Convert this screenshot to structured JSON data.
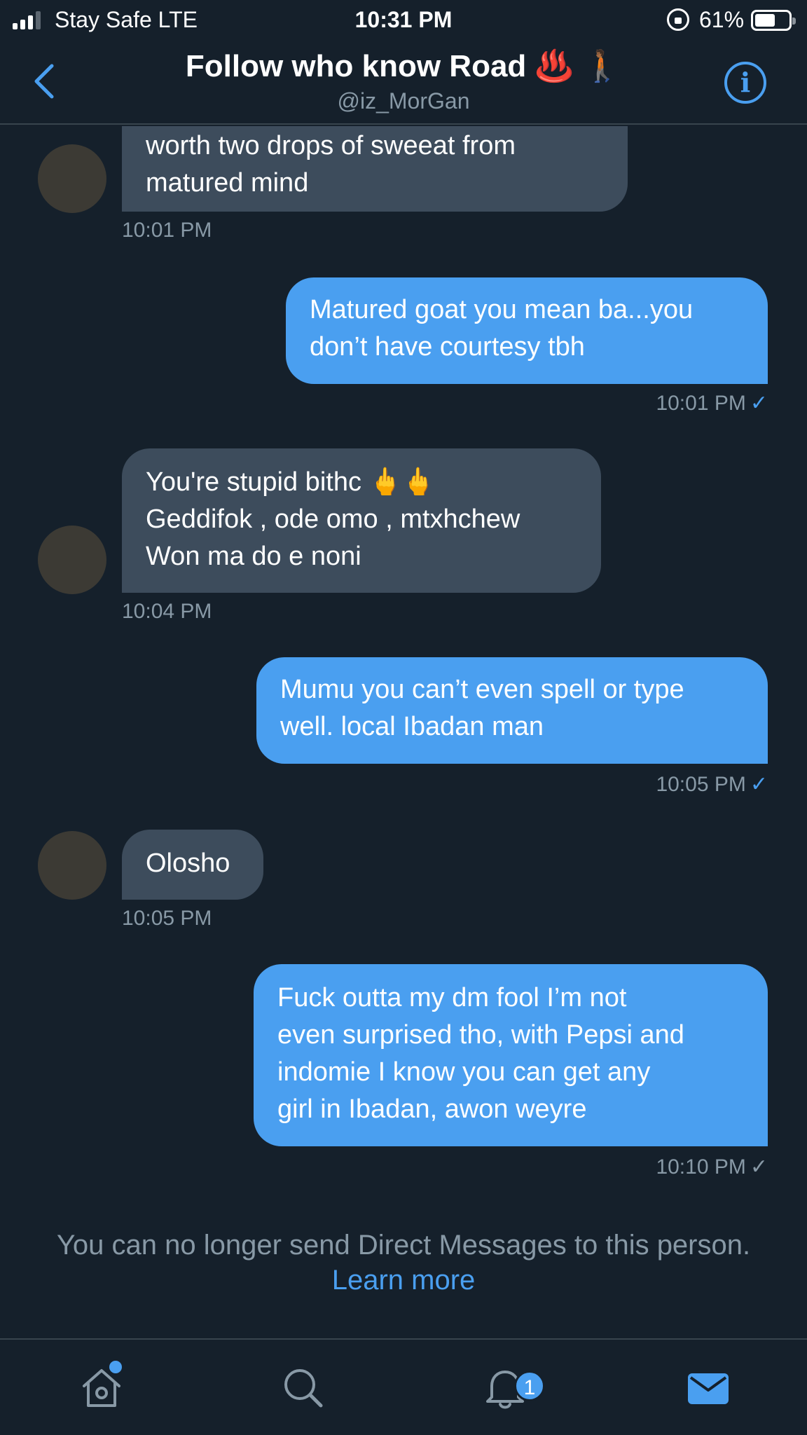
{
  "status_bar": {
    "carrier": "Stay Safe  LTE",
    "time": "10:31 PM",
    "battery_percent": "61%",
    "battery_level": 0.61
  },
  "header": {
    "title": "Follow who know Road",
    "title_emoji": "♨️ 🚶🏾",
    "handle": "@iz_MorGan",
    "info_icon": "i"
  },
  "messages": [
    {
      "direction": "in",
      "lines": [
        "worth two drops of sweeat from",
        "matured mind"
      ],
      "time": "10:01 PM"
    },
    {
      "direction": "out",
      "lines": [
        "Matured goat you mean ba...you",
        "don’t have courtesy tbh"
      ],
      "time": "10:01 PM",
      "status": "✓"
    },
    {
      "direction": "in",
      "lines": [
        "You're stupid bithc 🖕🖕",
        "Geddifok , ode omo ,  mtxhchew",
        "Won ma do e noni"
      ],
      "time": "10:04 PM"
    },
    {
      "direction": "out",
      "lines": [
        "Mumu you can’t even spell or type",
        "well. local Ibadan man"
      ],
      "time": "10:05 PM",
      "status": "✓"
    },
    {
      "direction": "in",
      "lines": [
        "Olosho"
      ],
      "time": "10:05 PM"
    },
    {
      "direction": "out",
      "lines": [
        "Fuck outta my dm fool I’m not",
        "even surprised tho, with Pepsi and",
        "indomie I know you can get any",
        "girl in Ibadan, awon weyre"
      ],
      "time": "10:10 PM",
      "status": "✓"
    }
  ],
  "notice": {
    "text": "You can no longer send Direct Messages to this person.",
    "link": "Learn more"
  },
  "tabbar": {
    "items": [
      "home-icon",
      "search-icon",
      "notifications-icon",
      "messages-icon"
    ],
    "notifications_badge": "1",
    "active": "messages-icon"
  },
  "colors": {
    "background": "#15202b",
    "incoming_bubble": "#3d4c5c",
    "outgoing_bubble": "#4a9ff0",
    "accent": "#4a9ff0",
    "muted_text": "#8899a6"
  }
}
